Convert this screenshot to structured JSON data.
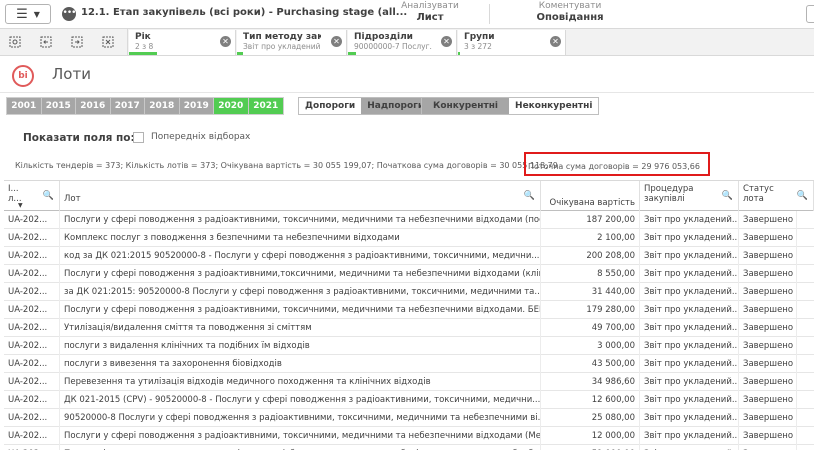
{
  "toolbar": {
    "app_title": "12.1. Етап закупівель (всі роки) - Purchasing stage (all...",
    "analyze_small": "Аналізувати",
    "analyze_big": "Лист",
    "narrate_small": "Коментувати",
    "narrate_big": "Оповідання"
  },
  "selections": [
    {
      "name": "Рік",
      "value": "2 з 8"
    },
    {
      "name": "Тип методу заку...",
      "value": "Звіт про укладений ..."
    },
    {
      "name": "Підрозділи",
      "value": "90000000-7 Послуг..."
    },
    {
      "name": "Групи",
      "value": "3 з 272"
    }
  ],
  "sheet": {
    "title": "Лоти",
    "logo_text": "bi"
  },
  "years": [
    "2001",
    "2015",
    "2016",
    "2017",
    "2018",
    "2019",
    "2020",
    "2021"
  ],
  "selected_years": [
    "2020",
    "2021"
  ],
  "threshold": {
    "below": "Допороги",
    "above": "Надпороги"
  },
  "competition": {
    "competitive": "Конкурентні",
    "noncompetitive": "Неконкурентні"
  },
  "show_fields": {
    "label": "Показати поля по:",
    "checkbox_label": "Попередніх відборах"
  },
  "summary": {
    "text": "Кількість тендерів = 373; Кількість лотів = 373; Очікувана вартість = 30 055 199,07; Початкова сума договорів = 30 055 118,79",
    "highlight": "Поточна сума договорів = 29 976 053,66"
  },
  "table": {
    "headers": {
      "id": "І... л...",
      "lot": "Лот",
      "expected": "Очікувана вартість",
      "procedure": "Процедура закупівлі",
      "status": "Статус лота"
    },
    "rows": [
      {
        "id": "UA-202...",
        "lot": "Послуги у сфері поводження з радіоактивними, токсичними, медичними та небезпечними відходами (пос...",
        "expected": "187 200,00",
        "procedure": "Звіт про укладений...",
        "status": "Завершено"
      },
      {
        "id": "UA-202...",
        "lot": "Комплекс послуг з поводження з безпечними та небезпечними відходами",
        "expected": "2 100,00",
        "procedure": "Звіт про укладений...",
        "status": "Завершено"
      },
      {
        "id": "UA-202...",
        "lot": "код за ДК 021:2015 90520000-8 - Послуги у сфері поводження з радіоактивними, токсичними, медични...",
        "expected": "200 208,00",
        "procedure": "Звіт про укладений...",
        "status": "Завершено"
      },
      {
        "id": "UA-202...",
        "lot": "Послуги у сфері поводження з радіоактивними,токсичними, медичними та небезпечними відходами (клін...",
        "expected": "8 550,00",
        "procedure": "Звіт про укладений...",
        "status": "Завершено"
      },
      {
        "id": "UA-202...",
        "lot": "за ДК 021:2015: 90520000-8 Послуги у сфері поводження з радіоактивними, токсичними, медичними та...",
        "expected": "31 440,00",
        "procedure": "Звіт про укладений...",
        "status": "Завершено"
      },
      {
        "id": "UA-202...",
        "lot": "Послуги у сфері поводження з радіоактивними, токсичними, медичними та небезпечними відходами. БЕН...",
        "expected": "179 280,00",
        "procedure": "Звіт про укладений...",
        "status": "Завершено"
      },
      {
        "id": "UA-202...",
        "lot": "Утилізація/видалення сміття та поводження зі сміттям",
        "expected": "49 700,00",
        "procedure": "Звіт про укладений...",
        "status": "Завершено"
      },
      {
        "id": "UA-202...",
        "lot": "послуги з видалення клінічних та подібних їм відходів",
        "expected": "3 000,00",
        "procedure": "Звіт про укладений...",
        "status": "Завершено"
      },
      {
        "id": "UA-202...",
        "lot": "послуги з вивезення та захоронення біовідходів",
        "expected": "43 500,00",
        "procedure": "Звіт про укладений...",
        "status": "Завершено"
      },
      {
        "id": "UA-202...",
        "lot": "Перевезення та утилізація відходів медичного походження та клінічних відходів",
        "expected": "34 986,60",
        "procedure": "Звіт про укладений...",
        "status": "Завершено"
      },
      {
        "id": "UA-202...",
        "lot": "ДК 021-2015 (CPV) - 90520000-8 - Послуги у сфері поводження з радіоактивними, токсичними, медични...",
        "expected": "12 600,00",
        "procedure": "Звіт про укладений...",
        "status": "Завершено"
      },
      {
        "id": "UA-202...",
        "lot": "90520000-8 Послуги у сфері поводження з радіоактивними, токсичними, медичними та небезпечними ві...",
        "expected": "25 080,00",
        "procedure": "Звіт про укладений...",
        "status": "Завершено"
      },
      {
        "id": "UA-202...",
        "lot": "Послуги у сфері поводження з радіоактивними, токсичними, медичними та небезпечними відходами (Ме...",
        "expected": "12 000,00",
        "procedure": "Звіт про укладений...",
        "status": "Завершено"
      },
      {
        "id": "UA-202...",
        "lot": "Послуги із поводження з медичними відходами (збирання, перевезення, зберігання, сортування, обробле...",
        "expected": "51 000,00",
        "procedure": "Звіт про укладений...",
        "status": "Завершено"
      }
    ]
  }
}
